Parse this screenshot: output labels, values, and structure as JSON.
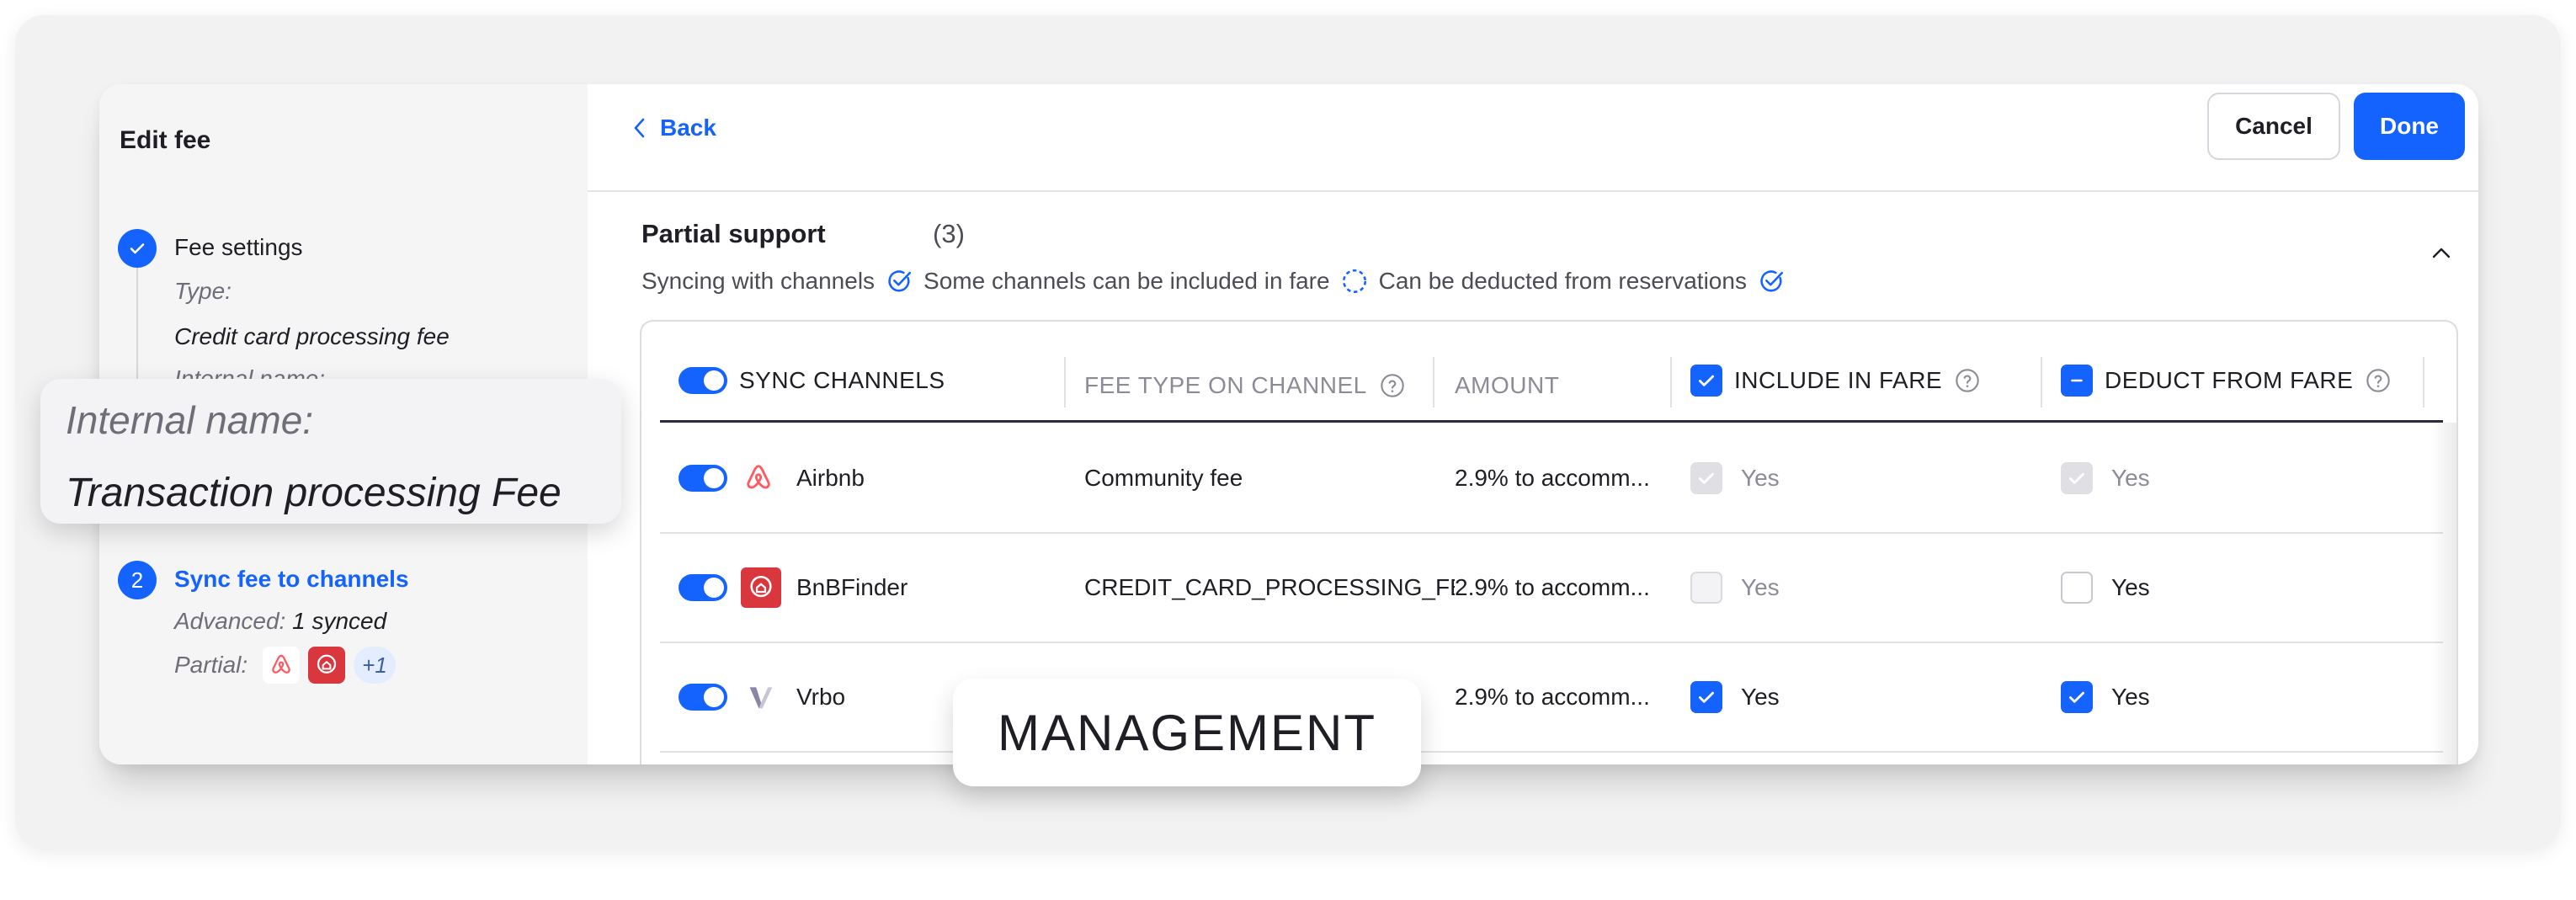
{
  "sidebar": {
    "title": "Edit fee",
    "step1": {
      "label": "Fee settings",
      "type_label": "Type:",
      "type_value": "Credit card processing fee",
      "internal_label": "Internal name:"
    },
    "step2": {
      "number": "2",
      "label": "Sync fee to channels",
      "advanced_label": "Advanced:",
      "advanced_value": "1 synced",
      "partial_label": "Partial:",
      "partial_extra": "+1"
    }
  },
  "overlays": {
    "internal_name_label": "Internal name:",
    "internal_name_value": "Transaction processing Fee",
    "management": "MANAGEMENT"
  },
  "topbar": {
    "back_label": "Back",
    "cancel_label": "Cancel",
    "done_label": "Done"
  },
  "section": {
    "title": "Partial support",
    "count": "(3)",
    "support_syncing": "Syncing with channels",
    "support_included": "Some channels can be included in fare",
    "support_deducted": "Can be deducted from reservations"
  },
  "table": {
    "headers": {
      "sync": "SYNC CHANNELS",
      "fee_type": "FEE TYPE ON CHANNEL",
      "amount": "AMOUNT",
      "include": "INCLUDE IN FARE",
      "deduct": "DEDUCT FROM FARE"
    },
    "rows": [
      {
        "channel": "Airbnb",
        "fee_type": "Community fee",
        "amount": "2.9% to accomm...",
        "include": "Yes",
        "deduct": "Yes"
      },
      {
        "channel": "BnBFinder",
        "fee_type": "CREDIT_CARD_PROCESSING_FEE",
        "amount": "2.9% to accomm...",
        "include": "Yes",
        "deduct": "Yes"
      },
      {
        "channel": "Vrbo",
        "fee_type": "",
        "amount": "2.9% to accomm...",
        "include": "Yes",
        "deduct": "Yes"
      }
    ]
  },
  "colors": {
    "accent": "#1463ff",
    "airbnb": "#ff5a5f",
    "bnbfinder": "#d9363e",
    "sidebar_bg": "#f5f5f6"
  },
  "icons": {
    "back": "chevron-left-icon",
    "collapse": "chevron-up-icon",
    "step_done": "check-icon",
    "support": [
      "check-circle-icon",
      "dashed-circle-icon",
      "check-circle-icon"
    ],
    "help": "question-circle-icon",
    "channels": [
      "airbnb-logo-icon",
      "bnbfinder-logo-icon",
      "vrbo-logo-icon"
    ]
  }
}
